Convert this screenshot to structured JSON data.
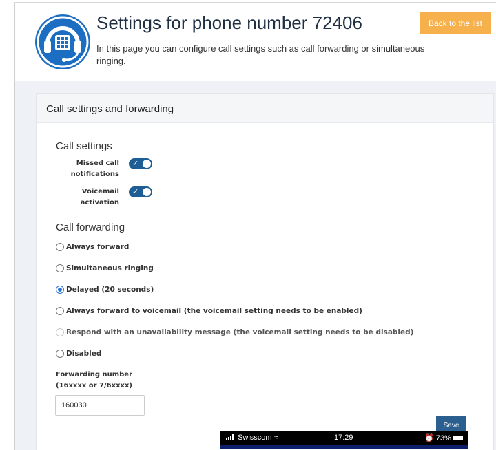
{
  "header": {
    "title": "Settings for phone number 72406",
    "subtitle": "In this page you can configure call settings such as call forwarding or simultaneous ringing.",
    "back_button": "Back to the list",
    "logo_icon": "headset-phone-icon",
    "accent_color": "#f6b04c",
    "logo_color": "#1b6ec2"
  },
  "card": {
    "title": "Call settings and forwarding"
  },
  "call_settings": {
    "title": "Call settings",
    "toggles": [
      {
        "label_line1": "Missed call",
        "label_line2": "notifications",
        "on": true
      },
      {
        "label_line1": "Voicemail",
        "label_line2": "activation",
        "on": true
      }
    ]
  },
  "call_forwarding": {
    "title": "Call forwarding",
    "options": [
      {
        "label": "Always forward",
        "checked": false,
        "disabled": false
      },
      {
        "label": "Simultaneous ringing",
        "checked": false,
        "disabled": false
      },
      {
        "label": "Delayed (20 seconds)",
        "checked": true,
        "disabled": false
      },
      {
        "label": "Always forward to voicemail (the voicemail setting needs to be enabled)",
        "checked": false,
        "disabled": false
      },
      {
        "label": "Respond with an unavailability message (the voicemail setting needs to be disabled)",
        "checked": false,
        "disabled": true
      },
      {
        "label": "Disabled",
        "checked": false,
        "disabled": false
      }
    ],
    "forwarding_number_label_line1": "Forwarding number",
    "forwarding_number_label_line2": "(16xxxx or 7/6xxxx)",
    "forwarding_number_value": "160030"
  },
  "save_button": "Save",
  "statusbar": {
    "carrier": "Swisscom",
    "time": "17:29",
    "battery": "73%"
  }
}
